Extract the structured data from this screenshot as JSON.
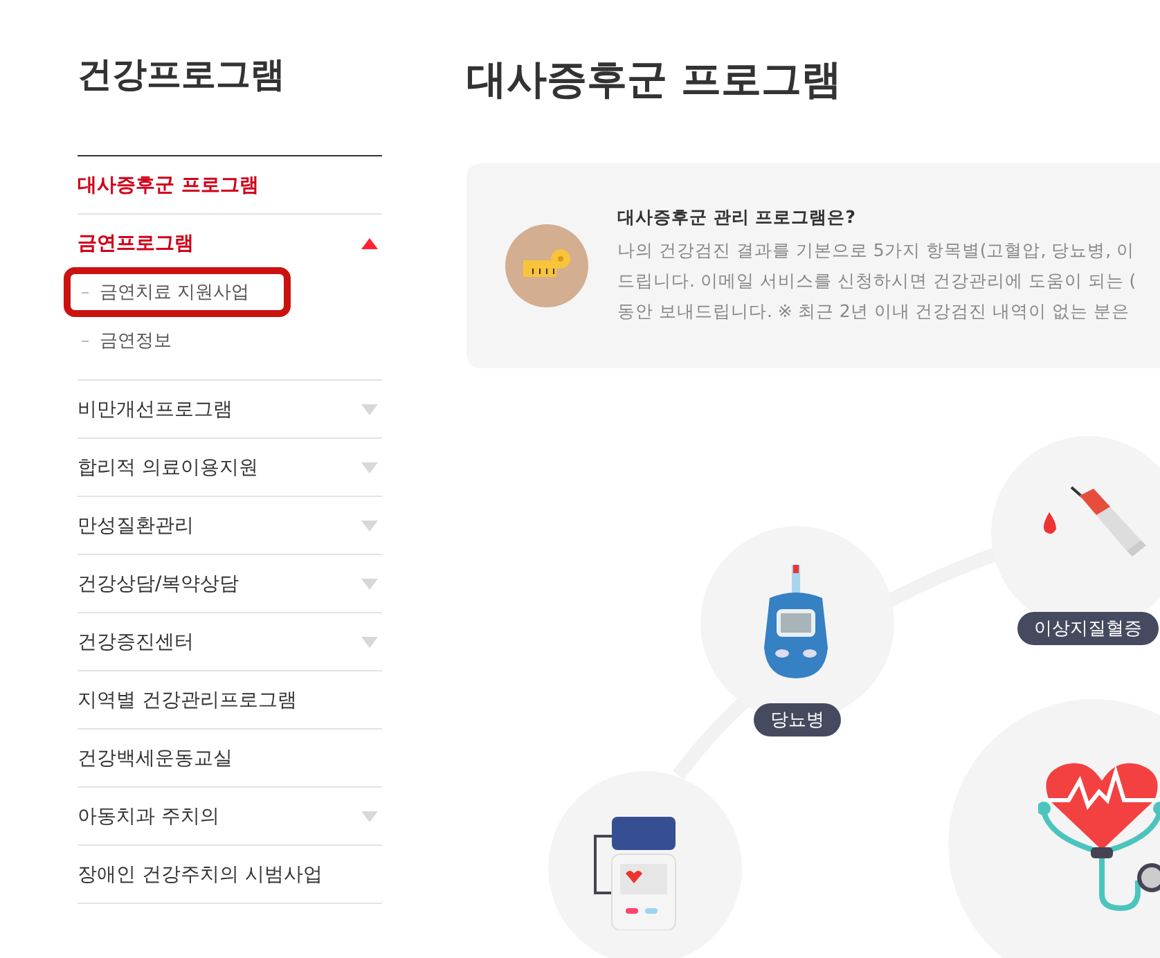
{
  "sidebar": {
    "title": "건강프로그램",
    "items": [
      {
        "label": "대사증후군 프로그램",
        "selected": true,
        "expandable": false,
        "expanded": false
      },
      {
        "label": "금연프로그램",
        "selected": true,
        "expandable": true,
        "expanded": true,
        "children": [
          {
            "label": "금연치료 지원사업",
            "highlighted": true
          },
          {
            "label": "금연정보",
            "highlighted": false
          }
        ]
      },
      {
        "label": "비만개선프로그램",
        "selected": false,
        "expandable": true,
        "expanded": false
      },
      {
        "label": "합리적 의료이용지원",
        "selected": false,
        "expandable": true,
        "expanded": false
      },
      {
        "label": "만성질환관리",
        "selected": false,
        "expandable": true,
        "expanded": false
      },
      {
        "label": "건강상담/복약상담",
        "selected": false,
        "expandable": true,
        "expanded": false
      },
      {
        "label": "건강증진센터",
        "selected": false,
        "expandable": true,
        "expanded": false
      },
      {
        "label": "지역별 건강관리프로그램",
        "selected": false,
        "expandable": false,
        "expanded": false
      },
      {
        "label": "건강백세운동교실",
        "selected": false,
        "expandable": false,
        "expanded": false
      },
      {
        "label": "아동치과 주치의",
        "selected": false,
        "expandable": true,
        "expanded": false
      },
      {
        "label": "장애인 건강주치의 시범사업",
        "selected": false,
        "expandable": false,
        "expanded": false
      }
    ]
  },
  "main": {
    "heading": "대사증후군 프로그램",
    "intro": {
      "title": "대사증후군 관리 프로그램은?",
      "lines": [
        "나의 건강검진 결과를 기본으로 5가지 항목별(고혈압, 당뇨병, 이",
        "드립니다. 이메일 서비스를 신청하시면 건강관리에 도움이 되는 (",
        "동안 보내드립니다. ※ 최근 2년 이내 건강검진 내역이 없는 분은"
      ]
    },
    "nodes": [
      {
        "kind": "meter",
        "label": "당뇨병"
      },
      {
        "kind": "syringe",
        "label": "이상지질혈증"
      },
      {
        "kind": "pressure"
      },
      {
        "kind": "heart"
      }
    ]
  }
}
